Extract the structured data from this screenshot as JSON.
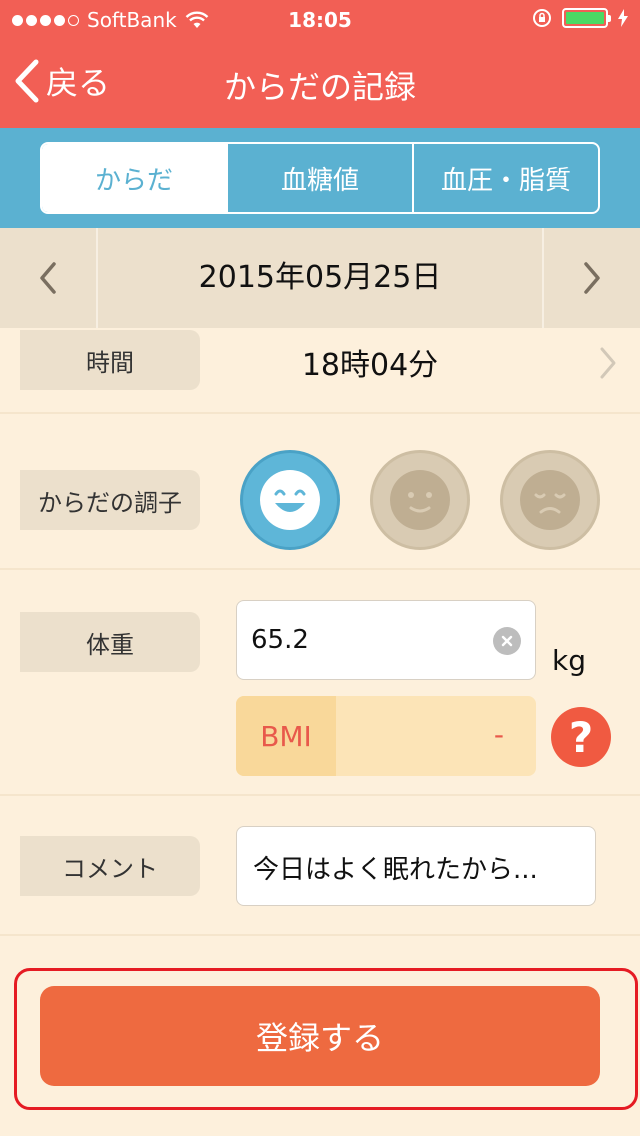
{
  "status_bar": {
    "carrier": "SoftBank",
    "time": "18:05"
  },
  "nav": {
    "back_label": "戻る",
    "title": "からだの記録"
  },
  "tabs": [
    {
      "label": "からだ",
      "active": true
    },
    {
      "label": "血糖値",
      "active": false
    },
    {
      "label": "血圧・脂質",
      "active": false
    }
  ],
  "date_nav": {
    "date": "2015年05月25日"
  },
  "time_row": {
    "label": "時間",
    "value": "18時04分"
  },
  "condition_row": {
    "label": "からだの調子",
    "options": [
      "smile-face-icon",
      "neutral-face-icon",
      "sad-face-icon"
    ],
    "selected": 0
  },
  "weight_row": {
    "label": "体重",
    "value": "65.2",
    "unit": "kg"
  },
  "bmi": {
    "label": "BMI",
    "value": "-"
  },
  "comment_row": {
    "label": "コメント",
    "value": "今日はよく眠れたから..."
  },
  "submit": {
    "label": "登録する"
  },
  "colors": {
    "header": "#f25f55",
    "tabs_bg": "#5bb1d1",
    "page_bg": "#fdf0dc",
    "button": "#ee6a40",
    "highlight": "#e51b23"
  }
}
